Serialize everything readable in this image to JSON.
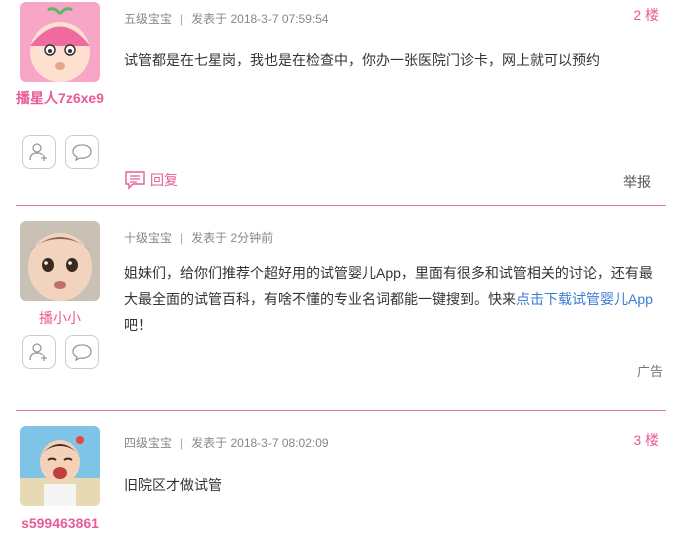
{
  "posts": [
    {
      "username": "播星人7z6xe9",
      "level": "五级宝宝",
      "posted": "发表于 2018-3-7 07:59:54",
      "floor": "2 楼",
      "content": "试管都是在七星岗，我也是在检查中，你办一张医院门诊卡，网上就可以预约",
      "reply_label": "回复",
      "report_label": "举报"
    },
    {
      "username": "播小小",
      "level": "十级宝宝",
      "posted": "发表于 2分钟前",
      "content_a": "姐妹们，给你们推荐个超好用的试管婴儿App，里面有很多和试管相关的讨论，还有最大最全面的试管百科，有啥不懂的专业名词都能一键搜到。快来",
      "content_link": "点击下载试管婴儿App",
      "content_b": "吧！",
      "ad_label": "广告"
    },
    {
      "username": "s599463861",
      "level": "四级宝宝",
      "posted": "发表于 2018-3-7 08:02:09",
      "floor": "3 楼",
      "content": "旧院区才做试管"
    }
  ],
  "icons": {
    "add_friend": "add-friend-icon",
    "message": "message-icon",
    "reply": "reply-icon"
  },
  "colors": {
    "accent": "#e85c96",
    "link": "#3a7bd5",
    "divider": "#e07aa8"
  }
}
